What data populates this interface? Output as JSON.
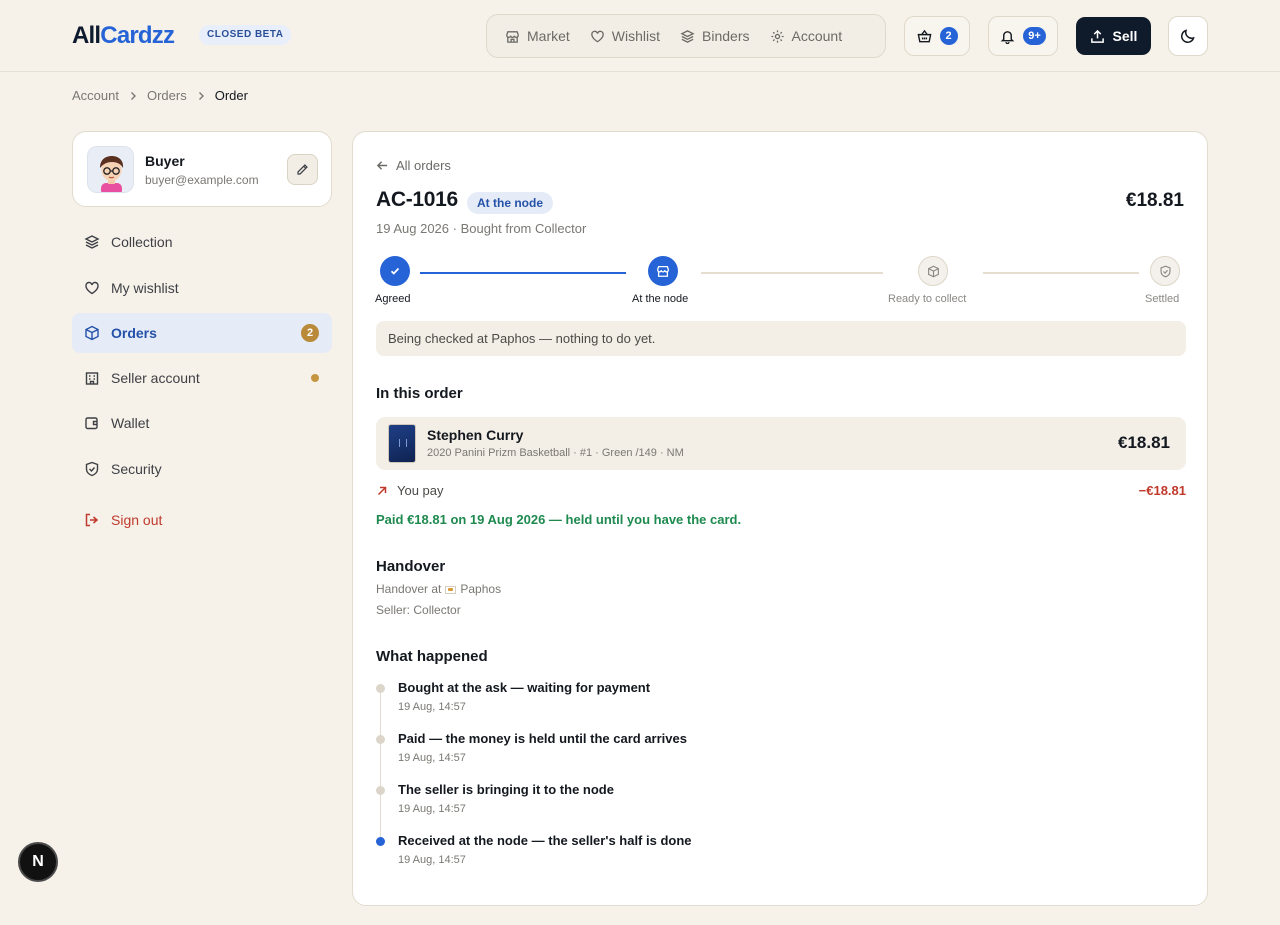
{
  "header": {
    "logo_part1": "All",
    "logo_part2": "Cardzz",
    "beta_label": "CLOSED BETA",
    "nav": [
      {
        "label": "Market",
        "icon": "store-icon"
      },
      {
        "label": "Wishlist",
        "icon": "heart-icon"
      },
      {
        "label": "Binders",
        "icon": "layers-icon"
      },
      {
        "label": "Account",
        "icon": "gear-icon"
      }
    ],
    "cart_count": "2",
    "notification_count": "9+",
    "sell_label": "Sell"
  },
  "breadcrumb": [
    "Account",
    "Orders",
    "Order"
  ],
  "profile": {
    "name": "Buyer",
    "email": "buyer@example.com"
  },
  "sidebar": {
    "items": [
      {
        "label": "Collection",
        "icon": "layers-icon"
      },
      {
        "label": "My wishlist",
        "icon": "heart-icon"
      },
      {
        "label": "Orders",
        "icon": "box-icon",
        "count": "2",
        "active": true
      },
      {
        "label": "Seller account",
        "icon": "building-icon",
        "dot": true
      },
      {
        "label": "Wallet",
        "icon": "wallet-icon"
      },
      {
        "label": "Security",
        "icon": "shield-icon"
      }
    ],
    "signout_label": "Sign out"
  },
  "order": {
    "back_label": "All orders",
    "id": "AC-1016",
    "status": "At the node",
    "total": "€18.81",
    "meta": "19 Aug 2026 · Bought from Collector",
    "steps": [
      "Agreed",
      "At the node",
      "Ready to collect",
      "Settled"
    ],
    "notice": "Being checked at Paphos — nothing to do yet.",
    "in_order_title": "In this order",
    "item": {
      "name": "Stephen Curry",
      "detail": "2020 Panini Prizm Basketball · #1 · Green /149 · NM",
      "price": "€18.81"
    },
    "pay_label": "You pay",
    "pay_amount": "−€18.81",
    "paid_note": "Paid €18.81 on 19 Aug 2026 — held until you have the card.",
    "handover_title": "Handover",
    "handover_prefix": "Handover at",
    "handover_place": "Paphos",
    "seller": "Seller: Collector",
    "history_title": "What happened",
    "history": [
      {
        "title": "Bought at the ask — waiting for payment",
        "time": "19 Aug, 14:57"
      },
      {
        "title": "Paid — the money is held until the card arrives",
        "time": "19 Aug, 14:57"
      },
      {
        "title": "The seller is bringing it to the node",
        "time": "19 Aug, 14:57"
      },
      {
        "title": "Received at the node — the seller's half is done",
        "time": "19 Aug, 14:57"
      }
    ]
  },
  "dev_badge_letter": "N"
}
